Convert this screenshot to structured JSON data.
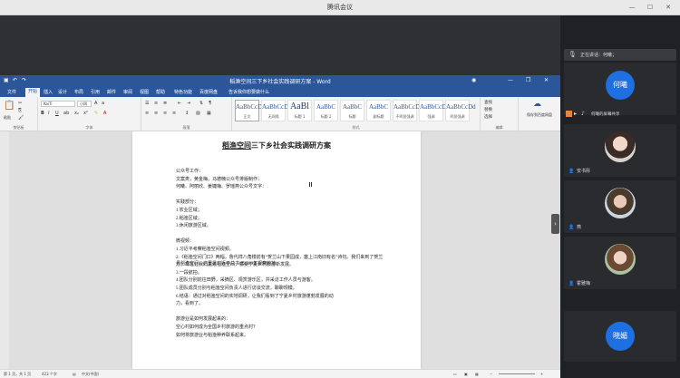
{
  "window": {
    "title": "腾讯会议"
  },
  "word": {
    "doc_title": "稻渔空间三下乡社会实践调研方案 - Word",
    "menu": [
      "文件",
      "开始",
      "插入",
      "设计",
      "布局",
      "引用",
      "邮件",
      "审阅",
      "视图",
      "帮助",
      "特色功能",
      "百度网盘",
      "告诉我你想要做什么"
    ],
    "ribbon": {
      "font_name": "KaiTi",
      "font_size": "小四",
      "clipboard_label": "剪贴板",
      "paste_label": "粘贴",
      "font_label": "字体",
      "paragraph_label": "段落",
      "styles_label": "样式",
      "editing_label": "编辑",
      "styles": [
        {
          "preview": "AaBbCcDd",
          "name": "正文"
        },
        {
          "preview": "AaBbCcDd",
          "name": "无间隔"
        },
        {
          "preview": "AaBl",
          "name": "标题 1"
        },
        {
          "preview": "AaBbC",
          "name": "标题 2"
        },
        {
          "preview": "AaBbC",
          "name": "标题"
        },
        {
          "preview": "AaBbC",
          "name": "副标题"
        },
        {
          "preview": "AaBbCcDd",
          "name": "不明显强调"
        },
        {
          "preview": "AaBbCcDd",
          "name": "强调"
        },
        {
          "preview": "AaBbCcDd",
          "name": "明显强调"
        }
      ],
      "find": "查找",
      "replace": "替换",
      "select": "选择",
      "save_baidu": "保存到百度网盘"
    },
    "document": {
      "title_pre": "",
      "title_u": "稻渔空间",
      "title_post": "三下乡社会实践调研方案",
      "lines": [
        {
          "text": "公众号工作：",
          "u": false
        },
        {
          "text": "文案类，黄金梅，马德楠公众号排版制作：",
          "u": false
        },
        {
          "text": "何曦、阿丽欣、姜婕梅、罗瑶燕公众号文字：",
          "u": false
        },
        {
          "text": "",
          "u": false
        },
        {
          "text": "实践部分：",
          "u": false
        },
        {
          "text": "1.农业区域；",
          "u": false
        },
        {
          "text": "2.稻渔区域；",
          "u": false
        },
        {
          "text": "3.休闲旅游区域。",
          "u": false
        },
        {
          "text": "",
          "u": false
        },
        {
          "text": "微视频：",
          "u": false
        },
        {
          "text": "1.习近平考察稻渔空间视频。",
          "u": false
        },
        {
          "text": "2.《稻渔空间门口》两幅，詹代祥八角楼前有“贺兰山下果园成，塞上江南旧有名”诗句。我们来到了贺兰县稻渔空间，这里是习近平总书记2020年视察的地",
          "u": false
        },
        {
          "text": "方。现在让我们走进稻渔空间，感受宁夏乡村旅游新发展。",
          "u": false
        },
        {
          "text": "3.一段航拍。",
          "u": false
        },
        {
          "text": "4.团队分别前往田野，采摘区、观赏游乐区，并采访工作人员与游客。",
          "u": false
        },
        {
          "text": "5.团队成员分别与稻渔空间负责人进行访谈交流，聊聊规模。",
          "u": false
        },
        {
          "text": "6.结语：通过对稻渔空间的实地调研，让我们看到了宁夏乡村旅游蓬勃发展的动",
          "u": false
        },
        {
          "text": "力，看到了。",
          "u": false
        },
        {
          "text": "",
          "u": false
        },
        {
          "text": "旅游业是如何发展起来的：",
          "u": false
        },
        {
          "text": "空心村如何成为全国乡村旅游的重点村？",
          "u": false
        },
        {
          "text": "如何将旅游业与稻渔种养联系起来。",
          "u": false
        }
      ]
    },
    "status": {
      "page": "第 1 页，共 1 页",
      "words": "423 个字",
      "lang": "中文(中国)"
    }
  },
  "meeting": {
    "speaking_prefix": "正在讲话：",
    "speaking_name": "何曦；",
    "share_label": "何曦的屏幕共享",
    "participants": [
      {
        "name": "",
        "avatar_text": "何曦",
        "type": "avatar"
      },
      {
        "name": "安书彤",
        "avatar_text": "",
        "type": "photo"
      },
      {
        "name": "燕",
        "avatar_text": "",
        "type": "photo"
      },
      {
        "name": "霍雅梅",
        "avatar_text": "",
        "type": "photo"
      },
      {
        "name": "",
        "avatar_text": "晓媚",
        "type": "avatar"
      }
    ]
  },
  "colors": {
    "word_blue": "#2b579a",
    "meeting_avatar": "#1e6fe0"
  }
}
